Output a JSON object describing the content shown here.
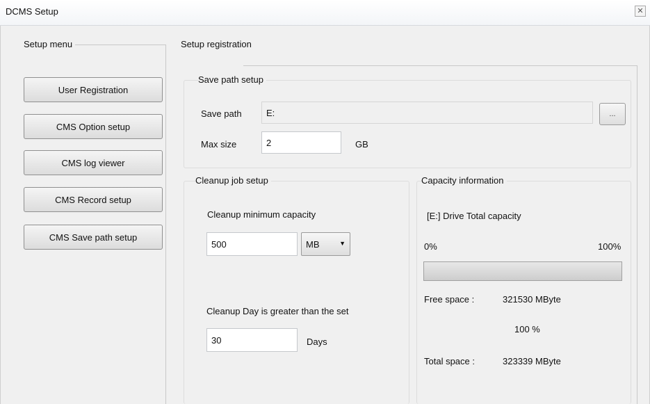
{
  "window": {
    "title": "DCMS Setup"
  },
  "setup_menu": {
    "label": "Setup menu",
    "items": [
      {
        "label": "User Registration"
      },
      {
        "label": "CMS Option setup"
      },
      {
        "label": "CMS log viewer"
      },
      {
        "label": "CMS Record setup"
      },
      {
        "label": "CMS Save path setup"
      }
    ]
  },
  "registration": {
    "label": "Setup registration"
  },
  "save_path_setup": {
    "label": "Save path setup",
    "save_path_label": "Save path",
    "save_path_value": "E:",
    "browse_label": "...",
    "max_size_label": "Max size",
    "max_size_value": "2",
    "max_size_unit": "GB"
  },
  "cleanup": {
    "label": "Cleanup job setup",
    "min_capacity_label": "Cleanup minimum capacity",
    "min_capacity_value": "500",
    "unit_selected": "MB",
    "day_label": "Cleanup Day is greater than the set",
    "day_value": "30",
    "day_unit": "Days"
  },
  "capacity": {
    "label": "Capacity information",
    "drive_label": "[E:] Drive Total capacity",
    "min_label": "0%",
    "max_label": "100%",
    "progress_fraction": 1.0,
    "free_label": "Free space :",
    "free_value": "321530 MByte",
    "percent_value": "100 %",
    "total_label": "Total space :",
    "total_value": "323339 MByte"
  }
}
